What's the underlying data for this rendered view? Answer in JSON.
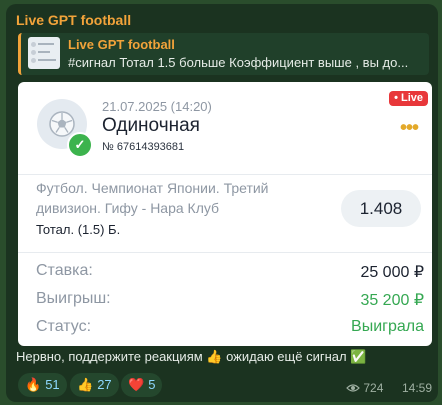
{
  "post": {
    "sender": "Live GPT football",
    "reply": {
      "title": "Live GPT football",
      "text": "#сигнал   Тотал 1.5 больше   Коэффициент выше , вы до..."
    },
    "bet": {
      "date": "21.07.2025 (14:20)",
      "type": "Одиночная",
      "number": "№ 67614393681",
      "live_badge": "• Live",
      "more": "•••",
      "match": "Футбол. Чемпионат Японии. Третий дивизион. Гифу - Нара Клуб",
      "market": "Тотал. (1.5) Б.",
      "odds": "1.408",
      "rows": [
        {
          "label": "Ставка:",
          "value": "25 000 ₽",
          "color": "#1c2330"
        },
        {
          "label": "Выигрыш:",
          "value": "35 200 ₽",
          "color": "#35a852"
        },
        {
          "label": "Статус:",
          "value": "Выиграла",
          "color": "#35a852"
        }
      ],
      "check": "✓"
    },
    "caption": "Нервно, поддержите реакциям 👍 ожидаю ещё сигнал ✅",
    "reactions": [
      {
        "emoji": "🔥",
        "count": "51"
      },
      {
        "emoji": "👍",
        "count": "27"
      },
      {
        "emoji": "❤️",
        "count": "5"
      }
    ],
    "views": "724",
    "time": "14:59"
  },
  "colors": {
    "accent": "#f2a33a",
    "win": "#35a852",
    "live": "#e8373a"
  }
}
